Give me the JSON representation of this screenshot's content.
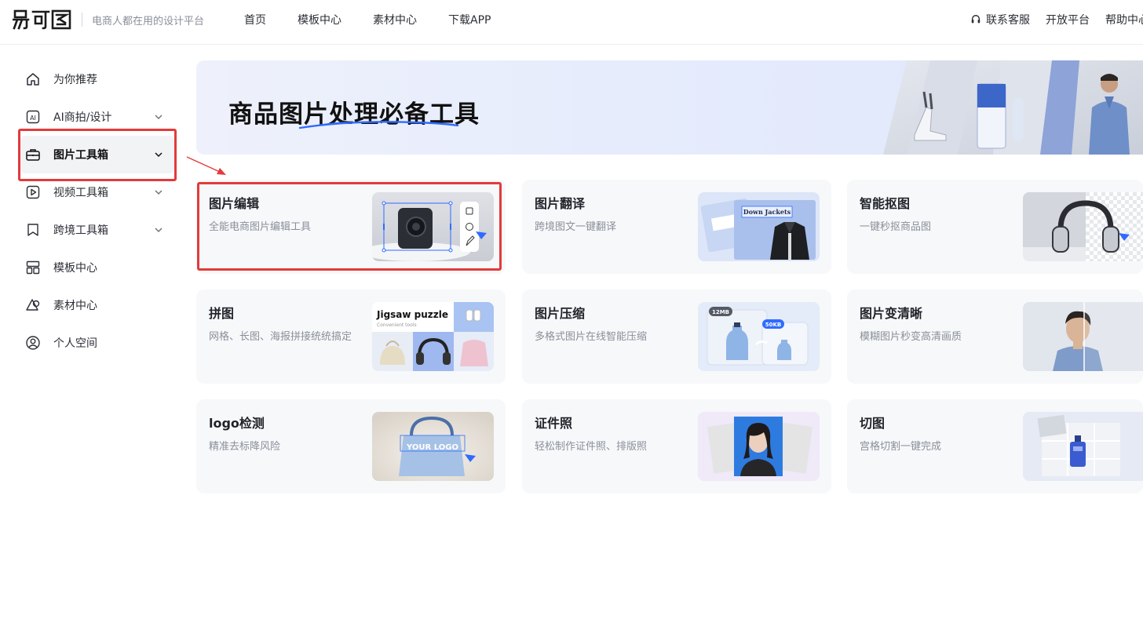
{
  "header": {
    "logo_text": "易可图",
    "slogan": "电商人都在用的设计平台",
    "nav": [
      "首页",
      "模板中心",
      "素材中心",
      "下载APP"
    ],
    "right": [
      "联系客服",
      "开放平台",
      "帮助中心"
    ]
  },
  "sidebar": {
    "items": [
      {
        "label": "为你推荐",
        "icon": "home-icon",
        "expandable": false
      },
      {
        "label": "AI商拍/设计",
        "icon": "ai-icon",
        "expandable": true
      },
      {
        "label": "图片工具箱",
        "icon": "toolbox-icon",
        "expandable": true,
        "active": true
      },
      {
        "label": "视频工具箱",
        "icon": "video-icon",
        "expandable": true
      },
      {
        "label": "跨境工具箱",
        "icon": "bookmark-icon",
        "expandable": true
      },
      {
        "label": "模板中心",
        "icon": "template-icon",
        "expandable": false
      },
      {
        "label": "素材中心",
        "icon": "shapes-icon",
        "expandable": false
      },
      {
        "label": "个人空间",
        "icon": "user-icon",
        "expandable": false
      }
    ]
  },
  "banner": {
    "title": "商品图片处理必备工具"
  },
  "cards": [
    {
      "title": "图片编辑",
      "desc": "全能电商图片编辑工具",
      "thumb": "edit"
    },
    {
      "title": "图片翻译",
      "desc": "跨境图文一键翻译",
      "thumb": "translate",
      "thumb_text": "Down Jackets"
    },
    {
      "title": "智能抠图",
      "desc": "一键秒抠商品图",
      "thumb": "cutout"
    },
    {
      "title": "拼图",
      "desc": "网格、长图、海报拼接统统搞定",
      "thumb": "jigsaw",
      "thumb_text": "Jigsaw puzzle",
      "thumb_sub": "Convenient tools"
    },
    {
      "title": "图片压缩",
      "desc": "多格式图片在线智能压缩",
      "thumb": "compress",
      "badge_before": "12MB",
      "badge_after": "50KB"
    },
    {
      "title": "图片变清晰",
      "desc": "模糊图片秒变高清画质",
      "thumb": "enhance"
    },
    {
      "title": "logo检测",
      "desc": "精准去标降风险",
      "thumb": "logo",
      "thumb_text": "YOUR LOGO"
    },
    {
      "title": "证件照",
      "desc": "轻松制作证件照、排版照",
      "thumb": "idphoto"
    },
    {
      "title": "切图",
      "desc": "宫格切割一键完成",
      "thumb": "slice"
    }
  ],
  "colors": {
    "accent_blue": "#2f6bff",
    "annotation_red": "#e23b3b"
  }
}
